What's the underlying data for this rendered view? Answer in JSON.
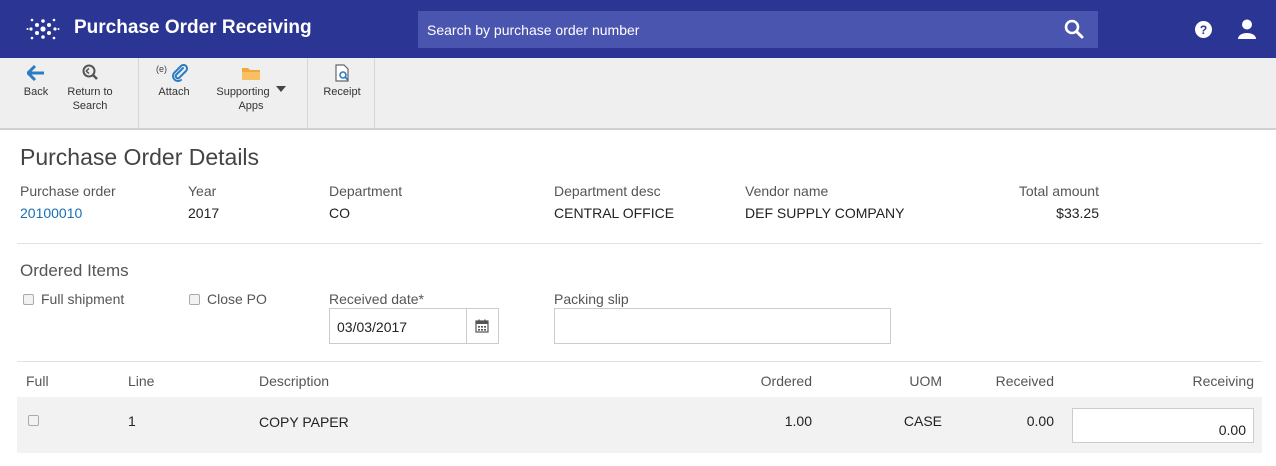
{
  "header": {
    "title": "Purchase Order Receiving",
    "search_placeholder": "Search by purchase order number",
    "icons": {
      "logo": "app-logo-icon",
      "search": "search-icon",
      "help": "help-icon",
      "user": "user-icon"
    }
  },
  "toolbar": {
    "back": {
      "label": "Back",
      "icon": "back-arrow-icon"
    },
    "return_to_search": {
      "line1": "Return to",
      "line2": "Search",
      "icon": "return-search-icon"
    },
    "attach": {
      "label": "Attach",
      "badge": "(e)",
      "icon": "paperclip-icon"
    },
    "supporting_apps": {
      "line1": "Supporting",
      "line2": "Apps",
      "icon": "folder-icon"
    },
    "receipt": {
      "label": "Receipt",
      "icon": "receipt-icon"
    }
  },
  "details": {
    "title": "Purchase Order Details",
    "fields": {
      "purchase_order": {
        "label": "Purchase order",
        "value": "20100010"
      },
      "year": {
        "label": "Year",
        "value": "2017"
      },
      "department": {
        "label": "Department",
        "value": "CO"
      },
      "department_desc": {
        "label": "Department desc",
        "value": "CENTRAL OFFICE"
      },
      "vendor_name": {
        "label": "Vendor name",
        "value": "DEF SUPPLY COMPANY"
      },
      "total_amount": {
        "label": "Total amount",
        "value": "$33.25"
      }
    }
  },
  "ordered_items": {
    "title": "Ordered Items",
    "full_shipment": {
      "label": "Full shipment",
      "checked": false
    },
    "close_po": {
      "label": "Close PO",
      "checked": false
    },
    "received_date": {
      "label": "Received date*",
      "value": "03/03/2017"
    },
    "packing_slip": {
      "label": "Packing slip",
      "value": ""
    },
    "columns": {
      "full": "Full",
      "line": "Line",
      "description": "Description",
      "ordered": "Ordered",
      "uom": "UOM",
      "received": "Received",
      "receiving": "Receiving"
    },
    "rows": [
      {
        "full": false,
        "line": "1",
        "description": "COPY PAPER",
        "ordered": "1.00",
        "uom": "CASE",
        "received": "0.00",
        "receiving": "0.00"
      }
    ]
  },
  "colors": {
    "header_bg": "#2b3593",
    "search_bg": "#4a55b0",
    "link": "#1a6fb5",
    "toolbar_bg": "#efefef"
  }
}
